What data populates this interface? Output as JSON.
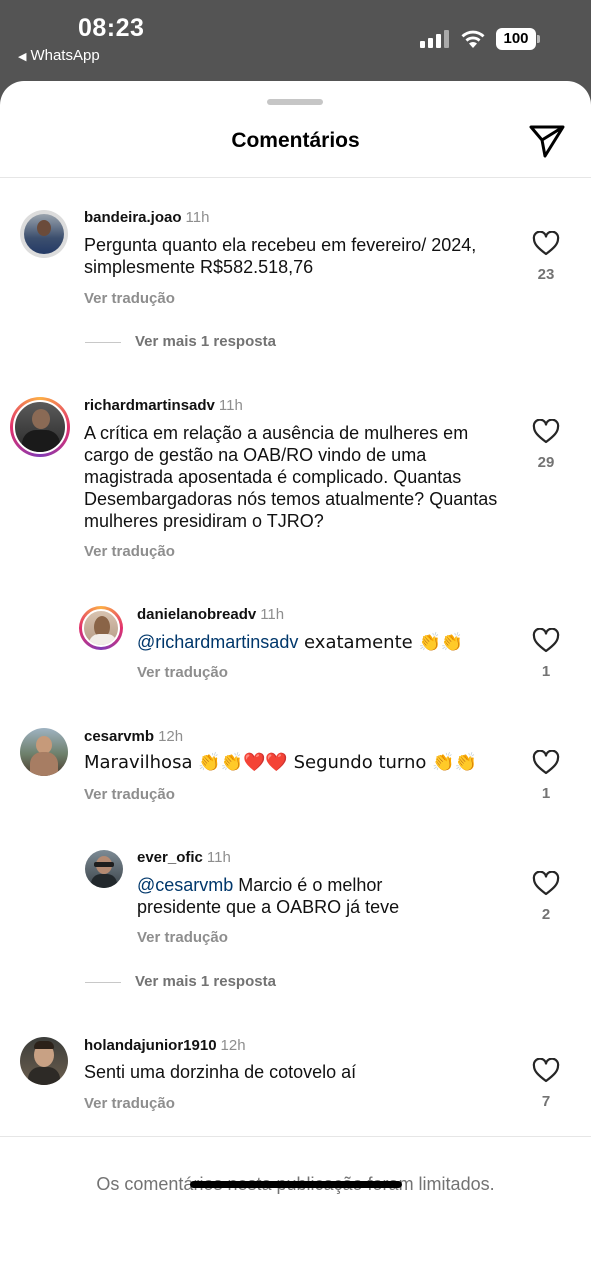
{
  "status_bar": {
    "time": "08:23",
    "back_app": "WhatsApp",
    "battery": "100"
  },
  "sheet": {
    "title": "Comentários",
    "send_icon": "send-icon"
  },
  "comments": [
    {
      "username": "bandeira.joao",
      "time": "11h",
      "text": "Pergunta quanto ela recebeu em fevereiro/ 2024, simplesmente R$582.518,76",
      "translate": "Ver tradução",
      "likes": "23",
      "more_replies": "Ver mais 1 resposta"
    },
    {
      "username": "richardmartinsadv",
      "time": "11h",
      "text": "A crítica em relação a ausência de mulheres em cargo de gestão na OAB/RO vindo de uma magistrada aposentada é complicado. Quantas Desembargadoras nós temos atualmente? Quantas mulheres presidiram o TJRO?",
      "translate": "Ver tradução",
      "likes": "29",
      "reply": {
        "username": "danielanobreadv",
        "time": "11h",
        "mention": "@richardmartinsadv",
        "text": " exatamente 👏👏",
        "translate": "Ver tradução",
        "likes": "1"
      }
    },
    {
      "username": "cesarvmb",
      "time": "12h",
      "text": "Maravilhosa 👏👏❤️❤️ Segundo turno 👏👏",
      "translate": "Ver tradução",
      "likes": "1",
      "reply": {
        "username": "ever_ofic",
        "time": "11h",
        "mention": "@cesarvmb",
        "text": " Marcio é o melhor presidente que a OABRO já teve",
        "translate": "Ver tradução",
        "likes": "2"
      },
      "more_replies": "Ver mais 1 resposta"
    },
    {
      "username": "holandajunior1910",
      "time": "12h",
      "text": "Senti uma dorzinha de cotovelo aí",
      "translate": "Ver tradução",
      "likes": "7"
    }
  ],
  "footer": {
    "limited_notice": "Os comentários nesta publicação foram limitados."
  },
  "colors": {
    "mention": "#00376b",
    "muted": "#8e8e8e",
    "background_dim": "#545454"
  }
}
